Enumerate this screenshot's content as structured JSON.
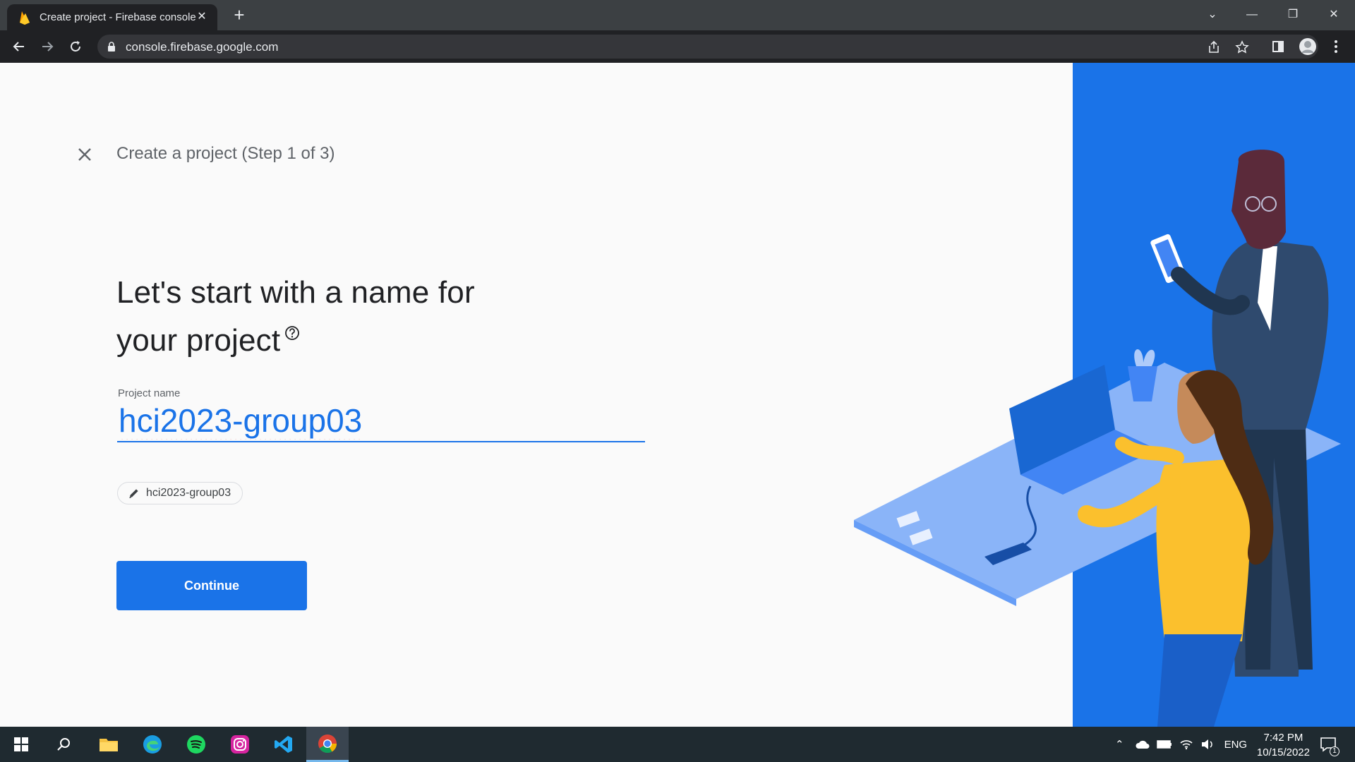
{
  "browser": {
    "tab_title": "Create project - Firebase console",
    "url": "console.firebase.google.com"
  },
  "page": {
    "step_title": "Create a project (Step 1 of 3)",
    "headline_line1": "Let's start with a name for",
    "headline_line2": "your project",
    "field_label": "Project name",
    "field_value": "hci2023-group03",
    "project_id_chip": "hci2023-group03",
    "continue_label": "Continue"
  },
  "taskbar": {
    "language": "ENG",
    "time": "7:42 PM",
    "date": "10/15/2022",
    "notification_count": "1"
  },
  "colors": {
    "accent": "#1a73e8",
    "illustration_bg": "#1a73e8"
  }
}
